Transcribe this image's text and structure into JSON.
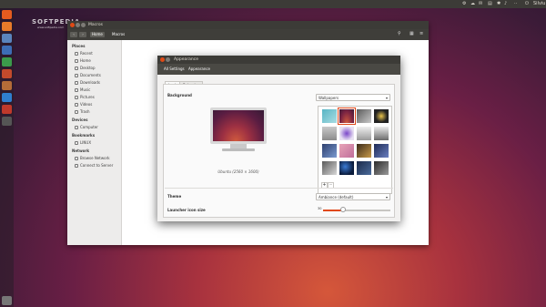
{
  "top_panel": {
    "user": "Silviu"
  },
  "watermark": {
    "brand": "SOFTPEDIA",
    "url": "www.softpedia.com"
  },
  "files_window": {
    "title": "Macros",
    "path": [
      "Home",
      "Macros"
    ],
    "sidebar": {
      "places_header": "Places",
      "places": [
        "Recent",
        "Home",
        "Desktop",
        "Documents",
        "Downloads",
        "Music",
        "Pictures",
        "Videos",
        "Trash"
      ],
      "devices_header": "Devices",
      "devices": [
        "Computer"
      ],
      "bookmarks_header": "Bookmarks",
      "bookmarks": [
        "LINUX"
      ],
      "network_header": "Network",
      "network": [
        "Browse Network",
        "Connect to Server"
      ]
    }
  },
  "appearance_window": {
    "title": "Appearance",
    "breadcrumb": [
      "All Settings",
      "Appearance"
    ],
    "tabs": [
      "Look",
      "Behavior"
    ],
    "background_label": "Background",
    "wallpaper_caption": "Ubuntu (2560 × 1600)",
    "wallpaper_source": "Wallpapers",
    "theme_label": "Theme",
    "theme_value": "Ambiance (default)",
    "launcher_label": "Launcher icon size",
    "launcher_icon_size": 30,
    "launcher_icon_size_level": 0.3,
    "add_button": "+",
    "remove_button": "−",
    "colors": {
      "accent": "#e0491b",
      "titlebar": "#3c3b37"
    }
  },
  "launcher_icons": [
    "dash-icon",
    "firefox-icon",
    "files-icon",
    "libreoffice-writer-icon",
    "libreoffice-calc-icon",
    "libreoffice-impress-icon",
    "software-center-icon",
    "amazon-icon",
    "settings-icon",
    "workspaces-icon",
    "trash-icon"
  ]
}
